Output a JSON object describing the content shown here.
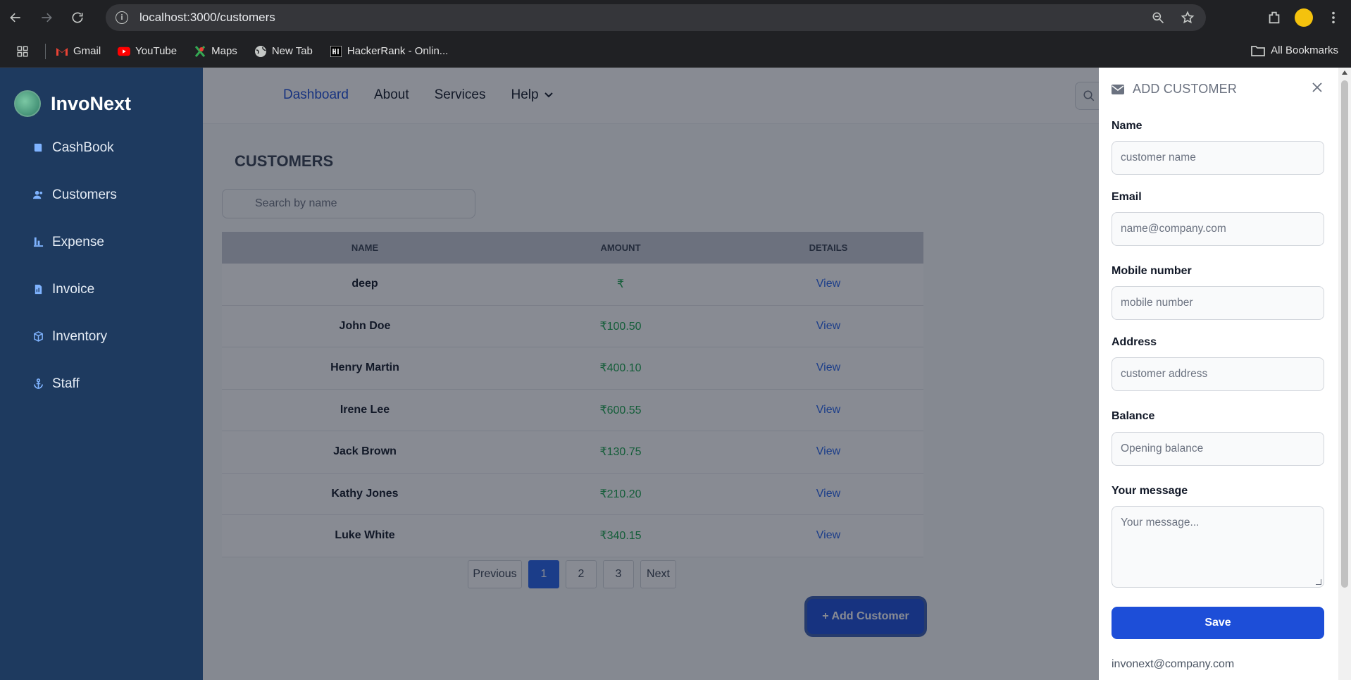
{
  "browser": {
    "url": "localhost:3000/customers",
    "bookmarks": [
      {
        "label": "Gmail",
        "icon": "gmail-icon"
      },
      {
        "label": "YouTube",
        "icon": "youtube-icon"
      },
      {
        "label": "Maps",
        "icon": "maps-icon"
      },
      {
        "label": "New Tab",
        "icon": "globe-icon"
      },
      {
        "label": "HackerRank - Onlin...",
        "icon": "hackerrank-icon"
      }
    ],
    "all_bookmarks": "All Bookmarks"
  },
  "sidebar": {
    "brand": "InvoNext",
    "items": [
      {
        "label": "CashBook",
        "icon": "book-icon"
      },
      {
        "label": "Customers",
        "icon": "users-icon"
      },
      {
        "label": "Expense",
        "icon": "chart-bar-icon"
      },
      {
        "label": "Invoice",
        "icon": "invoice-icon"
      },
      {
        "label": "Inventory",
        "icon": "cube-icon"
      },
      {
        "label": "Staff",
        "icon": "anchor-icon"
      }
    ]
  },
  "topnav": {
    "links": [
      "Dashboard",
      "About",
      "Services",
      "Help"
    ],
    "active": "Dashboard"
  },
  "main": {
    "title": "CUSTOMERS",
    "search_placeholder": "Search by name",
    "columns": [
      "NAME",
      "AMOUNT",
      "DETAILS"
    ],
    "rows": [
      {
        "name": "deep",
        "amount": "₹",
        "details": "View"
      },
      {
        "name": "John Doe",
        "amount": "₹100.50",
        "details": "View"
      },
      {
        "name": "Henry Martin",
        "amount": "₹400.10",
        "details": "View"
      },
      {
        "name": "Irene Lee",
        "amount": "₹600.55",
        "details": "View"
      },
      {
        "name": "Jack Brown",
        "amount": "₹130.75",
        "details": "View"
      },
      {
        "name": "Kathy Jones",
        "amount": "₹210.20",
        "details": "View"
      },
      {
        "name": "Luke White",
        "amount": "₹340.15",
        "details": "View"
      }
    ],
    "pagination": {
      "prev": "Previous",
      "pages": [
        "1",
        "2",
        "3"
      ],
      "current": "1",
      "next": "Next"
    },
    "add_button": "+ Add Customer"
  },
  "drawer": {
    "title": "ADD CUSTOMER",
    "fields": [
      {
        "label": "Name",
        "placeholder": "customer name"
      },
      {
        "label": "Email",
        "placeholder": "name@company.com"
      },
      {
        "label": "Mobile number",
        "placeholder": "mobile number"
      },
      {
        "label": "Address",
        "placeholder": "customer address"
      },
      {
        "label": "Balance",
        "placeholder": "Opening balance"
      },
      {
        "label": "Your message",
        "placeholder": "Your message..."
      }
    ],
    "save": "Save",
    "footer_email": "invonext@company.com"
  },
  "colors": {
    "sidebar_bg": "#1e3a5f",
    "primary": "#1d4ed8",
    "amount_green": "#16a34a"
  }
}
